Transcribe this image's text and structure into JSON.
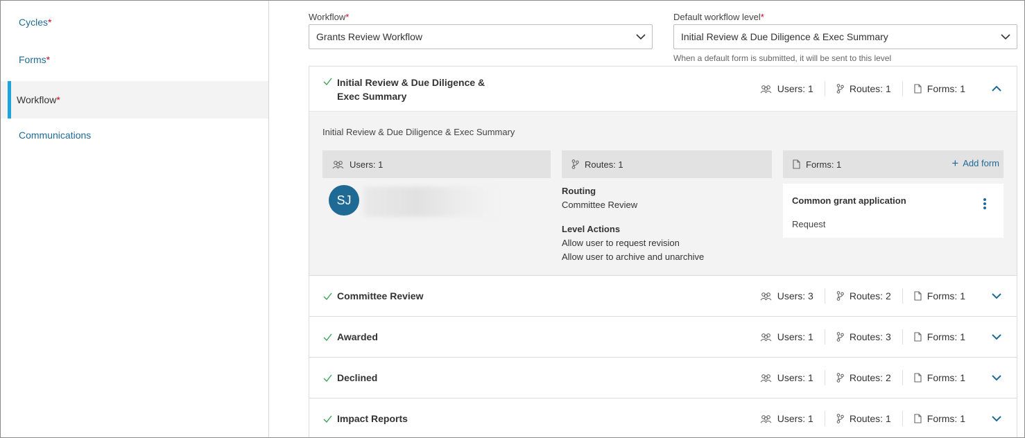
{
  "sidebar": {
    "items": [
      {
        "label": "Cycles",
        "required": "*"
      },
      {
        "label": "Forms",
        "required": "*"
      },
      {
        "label": "Workflow",
        "required": "*"
      },
      {
        "label": "Communications",
        "required": ""
      }
    ]
  },
  "workflow_field": {
    "label": "Workflow",
    "required": "*",
    "value": "Grants Review Workflow"
  },
  "default_level_field": {
    "label": "Default workflow level",
    "required": "*",
    "value": "Initial Review & Due Diligence & Exec Summary",
    "helper": "When a default form is submitted, it will be sent to this level"
  },
  "levels": [
    {
      "name_line1": "Initial Review & Due Diligence &",
      "name_line2": "Exec Summary",
      "users": "Users: 1",
      "routes": "Routes: 1",
      "forms": "Forms: 1",
      "expanded": true
    },
    {
      "name": "Committee Review",
      "users": "Users: 3",
      "routes": "Routes: 2",
      "forms": "Forms: 1"
    },
    {
      "name": "Awarded",
      "users": "Users: 1",
      "routes": "Routes: 3",
      "forms": "Forms: 1"
    },
    {
      "name": "Declined",
      "users": "Users: 1",
      "routes": "Routes: 2",
      "forms": "Forms: 1"
    },
    {
      "name": "Impact Reports",
      "users": "Users: 1",
      "routes": "Routes: 1",
      "forms": "Forms: 1"
    }
  ],
  "detail": {
    "title": "Initial Review & Due Diligence & Exec Summary",
    "users_header": "Users: 1",
    "routes_header": "Routes: 1",
    "forms_header": "Forms: 1",
    "add_form": "Add form",
    "user_initials": "SJ",
    "routing_heading": "Routing",
    "routing_value": "Committee Review",
    "level_actions_heading": "Level Actions",
    "level_actions": [
      "Allow user to request revision",
      "Allow user to archive and unarchive"
    ],
    "form_name": "Common grant application",
    "form_type": "Request"
  },
  "colors": {
    "accent": "#1f6a95",
    "active_bar": "#1ba4dd",
    "required": "#d0021b",
    "check": "#3aa35a"
  }
}
